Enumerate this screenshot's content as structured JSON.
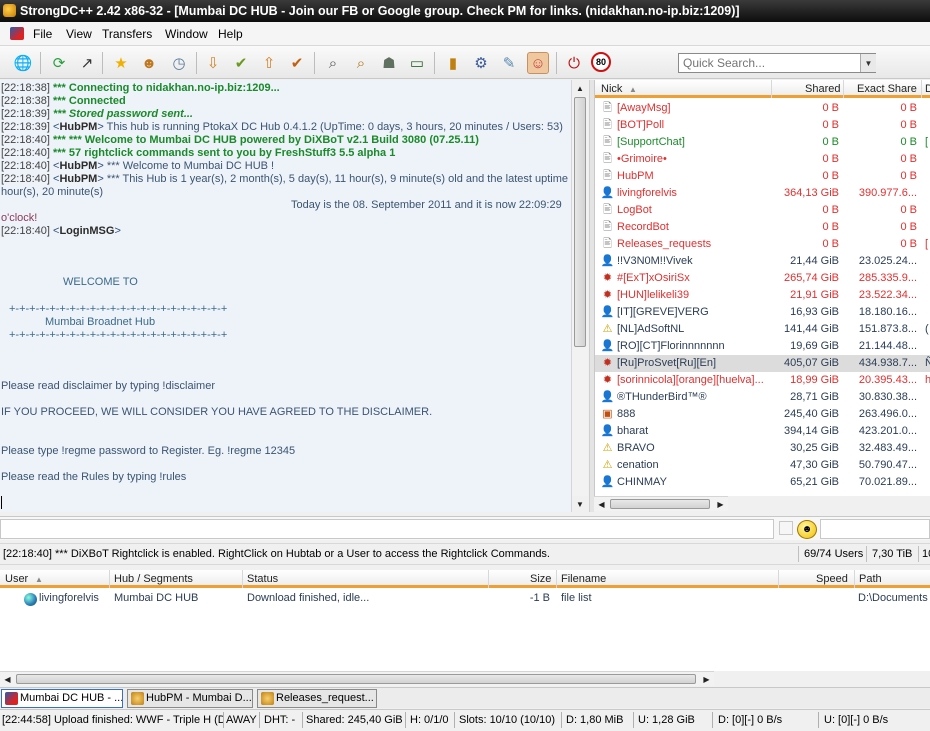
{
  "window": {
    "title": "StrongDC++ 2.42 x86-32 - [Mumbai DC HUB - Join our FB or Google group. Check PM for links. (nidakhan.no-ip.biz:1209)]"
  },
  "menu": {
    "file": "File",
    "view": "View",
    "transfers": "Transfers",
    "window": "Window",
    "help": "Help"
  },
  "toolbar": {
    "icons": [
      "public-hubs",
      "reconnect",
      "follow-redirect",
      "favorite-hubs",
      "favorite-users",
      "recent-hubs",
      "queue",
      "finished-downloads",
      "upload-queue",
      "finished-uploads",
      "search",
      "adl-search",
      "search-spy",
      "network-stats",
      "open-file-list",
      "settings",
      "notepad",
      "away",
      "limiter-off",
      "limiter-80"
    ],
    "limiter_value": "80",
    "more": "»"
  },
  "search": {
    "placeholder": "Quick Search..."
  },
  "chat": {
    "lines": [
      {
        "ts": "[22:18:38]",
        "text": "*** Connecting to nidakhan.no-ip.biz:1209...",
        "style": "green"
      },
      {
        "ts": "[22:18:38]",
        "text": "*** Connected",
        "style": "green"
      },
      {
        "ts": "[22:18:39]",
        "text": "*** Stored password sent...",
        "style": "green-i"
      },
      {
        "ts": "[22:18:39]",
        "nick": "HubPM",
        "text": "This hub is running PtokaX DC Hub 0.4.1.2 (UpTime: 0 days, 3 hours, 20 minutes / Users: 53)"
      },
      {
        "ts": "[22:18:40]",
        "text": "*** *** Welcome to Mumbai DC HUB powered by DiXBoT v2.1 Build 3080 (07.25.11)",
        "style": "green"
      },
      {
        "ts": "[22:18:40]",
        "text": "*** 57 rightclick commands sent to you by FreshStuff3 5.5 alpha 1",
        "style": "green"
      },
      {
        "ts": "[22:18:40]",
        "nick": "HubPM",
        "text": "*** Welcome to Mumbai DC HUB !"
      },
      {
        "ts": "[22:18:40]",
        "nick": "HubPM",
        "text": "*** This Hub is 1 year(s), 2 month(s), 5 day(s), 11 hour(s), 9 minute(s) old and the latest uptime is 3"
      },
      {
        "text": "hour(s), 20 minute(s)"
      },
      {
        "text": "Today is the 08. September 2011 and it is now 22:09:29"
      },
      {
        "text": "o'clock!"
      },
      {
        "ts": "[22:18:40]",
        "nick": "LoginMSG",
        "text": ""
      },
      {
        "text": "WELCOME TO"
      },
      {
        "text": "+-+-+-+-+-+-+-+-+-+-+-+-+-+-+-+-+-+-+-+-+-+"
      },
      {
        "text": "Mumbai Broadnet Hub"
      },
      {
        "text": "+-+-+-+-+-+-+-+-+-+-+-+-+-+-+-+-+-+-+-+-+-+"
      },
      {
        "text": "Please read disclaimer by typing  !disclaimer"
      },
      {
        "text": "IF YOU PROCEED, WE WILL CONSIDER YOU HAVE AGREED TO THE DISCLAIMER."
      },
      {
        "text": "Please type !regme password to Register. Eg. !regme 12345"
      },
      {
        "text": "Please read the Rules by typing !rules"
      }
    ]
  },
  "userlist": {
    "columns": {
      "nick": "Nick",
      "shared": "Shared",
      "exact": "Exact Share",
      "extra": "D"
    },
    "users": [
      {
        "nick": "[AwayMsg]",
        "shared": "0 B",
        "exact": "0 B",
        "extra": "",
        "color": "#e03030",
        "icon": "bot"
      },
      {
        "nick": "[BOT]Poll",
        "shared": "0 B",
        "exact": "0 B",
        "extra": "",
        "color": "#e03030",
        "icon": "bot"
      },
      {
        "nick": "[SupportChat]",
        "shared": "0 B",
        "exact": "0 B",
        "extra": "[",
        "color": "#1d8a2a",
        "icon": "bot"
      },
      {
        "nick": "•Grimoire•",
        "shared": "0 B",
        "exact": "0 B",
        "extra": "",
        "color": "#e03030",
        "icon": "bot"
      },
      {
        "nick": "HubPM",
        "shared": "0 B",
        "exact": "0 B",
        "extra": "",
        "color": "#e03030",
        "icon": "bot"
      },
      {
        "nick": "livingforelvis",
        "shared": "364,13 GiB",
        "exact": "390.977.6...",
        "extra": "",
        "color": "#e03030",
        "icon": "user"
      },
      {
        "nick": "LogBot",
        "shared": "0 B",
        "exact": "0 B",
        "extra": "",
        "color": "#e03030",
        "icon": "bot"
      },
      {
        "nick": "RecordBot",
        "shared": "0 B",
        "exact": "0 B",
        "extra": "",
        "color": "#e03030",
        "icon": "bot"
      },
      {
        "nick": "Releases_requests",
        "shared": "0 B",
        "exact": "0 B",
        "extra": "[",
        "color": "#e03030",
        "icon": "bot"
      },
      {
        "nick": "!!V3N0M!!Vivek",
        "shared": "21,44 GiB",
        "exact": "23.025.24...",
        "extra": "",
        "color": "#2b3d55",
        "icon": "user"
      },
      {
        "nick": "#[ExT]xOsiriSx",
        "shared": "265,74 GiB",
        "exact": "285.335.9...",
        "extra": "",
        "color": "#e03030",
        "icon": "op"
      },
      {
        "nick": "[HUN]lelikeli39",
        "shared": "21,91 GiB",
        "exact": "23.522.34...",
        "extra": "",
        "color": "#e03030",
        "icon": "op"
      },
      {
        "nick": "[IT][GREVE]VERG",
        "shared": "16,93 GiB",
        "exact": "18.180.16...",
        "extra": "",
        "color": "#2b3d55",
        "icon": "user"
      },
      {
        "nick": "[NL]AdSoftNL",
        "shared": "141,44 GiB",
        "exact": "151.873.8...",
        "extra": "(",
        "color": "#2b3d55",
        "icon": "warn"
      },
      {
        "nick": "[RO][CT]Florinnnnnnn",
        "shared": "19,69 GiB",
        "exact": "21.144.48...",
        "extra": "",
        "color": "#2b3d55",
        "icon": "user"
      },
      {
        "nick": "[Ru]ProSvet[Ru][En]",
        "shared": "405,07 GiB",
        "exact": "434.938.7...",
        "extra": "Ñ",
        "color": "#2b3d55",
        "icon": "op",
        "selected": true
      },
      {
        "nick": "[sorinnicola][orange][huelva]...",
        "shared": "18,99 GiB",
        "exact": "20.395.43...",
        "extra": "h",
        "color": "#e03030",
        "icon": "op"
      },
      {
        "nick": "®THunderBird™®",
        "shared": "28,71 GiB",
        "exact": "30.830.38...",
        "extra": "",
        "color": "#2b3d55",
        "icon": "user"
      },
      {
        "nick": "888",
        "shared": "245,40 GiB",
        "exact": "263.496.0...",
        "extra": "",
        "color": "#2b3d55",
        "icon": "box"
      },
      {
        "nick": "bharat",
        "shared": "394,14 GiB",
        "exact": "423.201.0...",
        "extra": "",
        "color": "#2b3d55",
        "icon": "user"
      },
      {
        "nick": "BRAVO",
        "shared": "30,25 GiB",
        "exact": "32.483.49...",
        "extra": "",
        "color": "#2b3d55",
        "icon": "warn"
      },
      {
        "nick": "cenation",
        "shared": "47,30 GiB",
        "exact": "50.790.47...",
        "extra": "",
        "color": "#2b3d55",
        "icon": "warn"
      },
      {
        "nick": "CHINMAY",
        "shared": "65,21 GiB",
        "exact": "70.021.89...",
        "extra": "",
        "color": "#2b3d55",
        "icon": "user"
      }
    ]
  },
  "hub_status": {
    "message": "[22:18:40] *** DiXBoT Rightclick is enabled. RightClick on Hubtab or a User to access the Rightclick Commands.",
    "users": "69/74 Users",
    "share": "7,30 TiB",
    "extra": "10"
  },
  "transfers": {
    "columns": {
      "user": "User",
      "hub": "Hub / Segments",
      "status": "Status",
      "size": "Size",
      "filename": "Filename",
      "speed": "Speed",
      "path": "Path"
    },
    "rows": [
      {
        "user": "livingforelvis",
        "hub": "Mumbai DC HUB",
        "status": "Download finished, idle...",
        "size": "-1 B",
        "filename": "file list",
        "speed": "",
        "path": "D:\\Documents"
      }
    ]
  },
  "tabs": [
    {
      "label": "Mumbai DC HUB - ...",
      "active": true
    },
    {
      "label": "HubPM - Mumbai D...",
      "active": false
    },
    {
      "label": "Releases_request...",
      "active": false
    }
  ],
  "statusbar": {
    "last": "[22:44:58] Upload finished: WWF - Triple H (Di",
    "away": "AWAY",
    "dht": "DHT: -",
    "shared": "Shared: 245,40 GiB",
    "hubs": "H: 0/1/0",
    "slots": "Slots: 10/10 (10/10)",
    "down": "D: 1,80 MiB",
    "up": "U: 1,28 GiB",
    "dspeed": "D: [0][-] 0 B/s",
    "uspeed": "U: [0][-] 0 B/s"
  }
}
